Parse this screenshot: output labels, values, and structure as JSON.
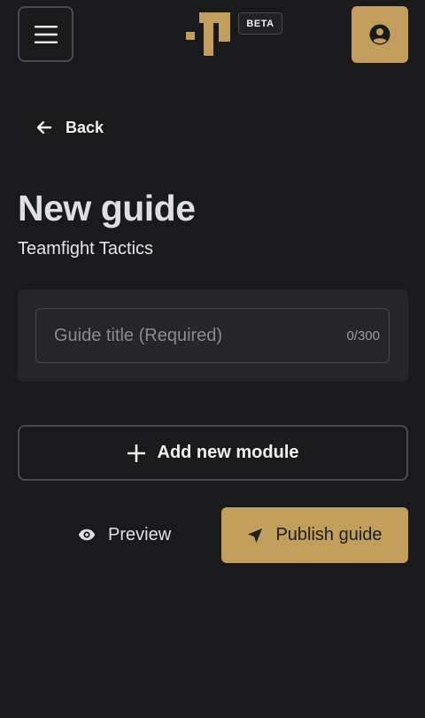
{
  "header": {
    "badge": "BETA",
    "brand_color": "#c29e5c",
    "menu_icon": "hamburger-icon",
    "profile_icon": "user-circle-icon"
  },
  "nav": {
    "back_label": "Back",
    "back_icon": "arrow-left-icon"
  },
  "page": {
    "title": "New guide",
    "subtitle": "Teamfight Tactics"
  },
  "form": {
    "title_placeholder": "Guide title (Required)",
    "title_value": "",
    "char_counter": "0/300"
  },
  "actions": {
    "add_module_label": "Add new module",
    "add_module_icon": "plus-icon",
    "preview_label": "Preview",
    "preview_icon": "eye-icon",
    "publish_label": "Publish guide",
    "publish_icon": "send-icon"
  }
}
